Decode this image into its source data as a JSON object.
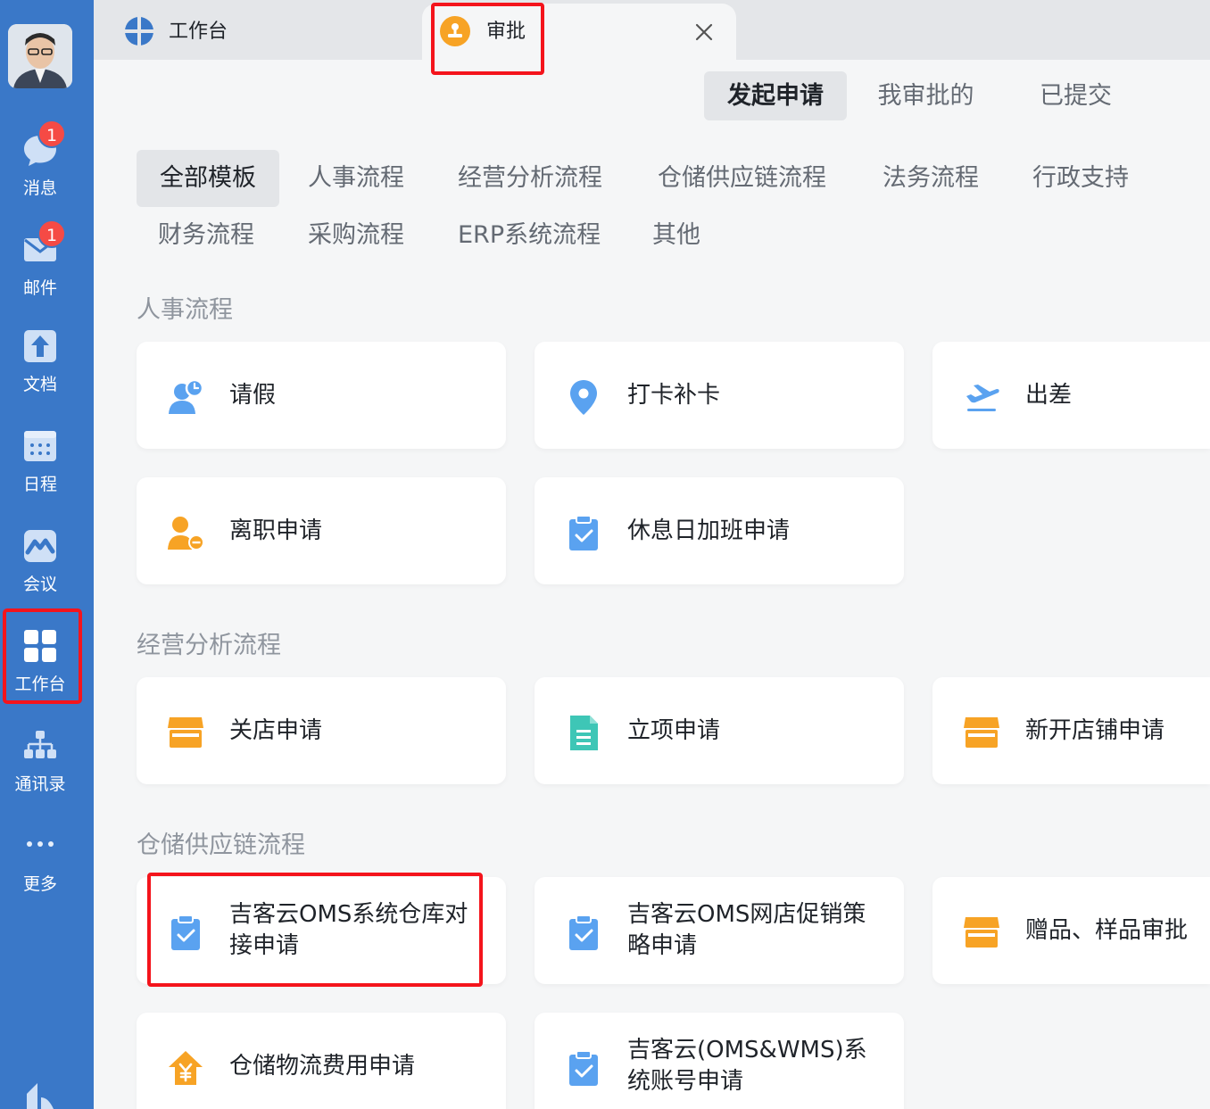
{
  "sidebar": {
    "items": [
      {
        "label": "消息",
        "icon": "chat-bubble-icon",
        "badge": "1"
      },
      {
        "label": "邮件",
        "icon": "mail-icon",
        "badge": "1"
      },
      {
        "label": "文档",
        "icon": "document-icon"
      },
      {
        "label": "日程",
        "icon": "calendar-icon"
      },
      {
        "label": "会议",
        "icon": "meeting-icon"
      },
      {
        "label": "工作台",
        "icon": "workbench-grid-icon",
        "active": true
      },
      {
        "label": "通讯录",
        "icon": "org-chart-icon"
      },
      {
        "label": "更多",
        "icon": "more-dots-icon"
      }
    ]
  },
  "tabs": {
    "workbench_label": "工作台",
    "approval_label": "审批"
  },
  "subtabs": [
    "发起申请",
    "我审批的",
    "已提交"
  ],
  "categories": [
    "全部模板",
    "人事流程",
    "经营分析流程",
    "仓储供应链流程",
    "法务流程",
    "行政支持",
    "财务流程",
    "采购流程",
    "ERP系统流程",
    "其他"
  ],
  "sections": [
    {
      "title": "人事流程",
      "cards": [
        {
          "label": "请假",
          "icon": "leave-user-clock-icon"
        },
        {
          "label": "打卡补卡",
          "icon": "location-pin-icon"
        },
        {
          "label": "出差",
          "icon": "airplane-icon"
        },
        {
          "label": "离职申请",
          "icon": "resign-user-minus-icon"
        },
        {
          "label": "休息日加班申请",
          "icon": "clipboard-check-icon"
        }
      ]
    },
    {
      "title": "经营分析流程",
      "cards": [
        {
          "label": "关店申请",
          "icon": "shop-icon"
        },
        {
          "label": "立项申请",
          "icon": "document-lines-icon"
        },
        {
          "label": "新开店铺申请",
          "icon": "shop-icon"
        }
      ]
    },
    {
      "title": "仓储供应链流程",
      "cards": [
        {
          "label": "吉客云OMS系统仓库对接申请",
          "icon": "clipboard-check-icon"
        },
        {
          "label": "吉客云OMS网店促销策略申请",
          "icon": "clipboard-check-icon"
        },
        {
          "label": "赠品、样品审批",
          "icon": "shop-icon"
        },
        {
          "label": "仓储物流费用申请",
          "icon": "yuan-house-icon"
        },
        {
          "label": "吉客云(OMS&WMS)系统账号申请",
          "icon": "clipboard-check-icon"
        }
      ]
    }
  ],
  "colors": {
    "sidebar": "#3a78c8",
    "highlight": "#f4141c",
    "badge": "#f54a45",
    "icon_blue": "#5aa2f0",
    "icon_orange": "#f7a325",
    "icon_teal": "#3ec6b6"
  }
}
